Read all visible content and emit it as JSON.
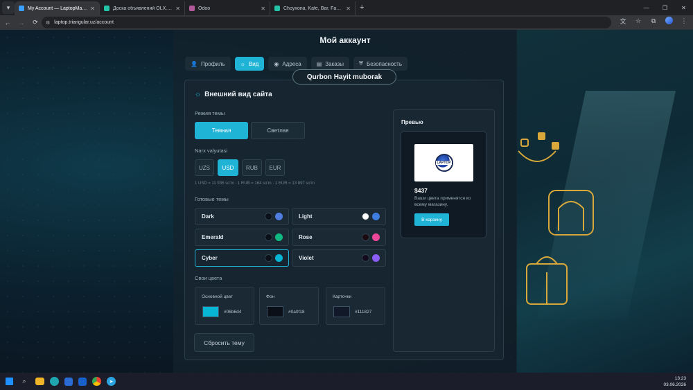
{
  "browser": {
    "tabs": [
      {
        "title": "My Account — LaptopMarket |",
        "active": true,
        "favicon_color": "#3aa0ff"
      },
      {
        "title": "Доска объявлений OLX.uz, ра",
        "active": false,
        "favicon_color": "#23c4a8"
      },
      {
        "title": "Odoo",
        "active": false,
        "favicon_color": "#b05a9b"
      },
      {
        "title": "Choyxona, Kafe, Bar, FastFood",
        "active": false,
        "favicon_color": "#23c4a8"
      }
    ],
    "new_tab": "+",
    "url": "laptop.triangular.uz/account",
    "window_controls": {
      "minimize": "—",
      "restore": "❐",
      "close": "✕"
    }
  },
  "page": {
    "title": "Мой аккаунт",
    "nav_tabs": [
      {
        "label": "Профиль",
        "icon": "👤",
        "active": false
      },
      {
        "label": "Вид",
        "icon": "☼",
        "active": true
      },
      {
        "label": "Адреса",
        "icon": "◉",
        "active": false
      },
      {
        "label": "Заказы",
        "icon": "▤",
        "active": false
      },
      {
        "label": "Безопасность",
        "icon": "⛨",
        "active": false
      }
    ],
    "banner": "Qurbon Hayit muborak",
    "appearance": {
      "title": "Внешний вид сайта",
      "theme_mode_label": "Режим темы",
      "dark_label": "Темная",
      "light_label": "Светлая",
      "currency_label": "Narx valyutasi",
      "currencies": [
        "UZS",
        "USD",
        "RUB",
        "EUR"
      ],
      "active_currency": "USD",
      "rates": "1 USD = 11 935 so'm · 1 RUB = 164 so'm · 1 EUR = 13 897 so'm",
      "themes_label": "Готовые темы",
      "themes": [
        {
          "name": "Dark",
          "c1": "#0a0f18",
          "c2": "#4f7de0"
        },
        {
          "name": "Light",
          "c1": "#ffffff",
          "c2": "#3f7de0"
        },
        {
          "name": "Emerald",
          "c1": "#0a0f18",
          "c2": "#10b981"
        },
        {
          "name": "Rose",
          "c1": "#1a0a10",
          "c2": "#ec4899"
        },
        {
          "name": "Cyber",
          "c1": "#0a0f18",
          "c2": "#06b6d4"
        },
        {
          "name": "Violet",
          "c1": "#140a1e",
          "c2": "#8b5cf6"
        }
      ],
      "selected_theme": "Cyber",
      "custom_colors_label": "Свои цвета",
      "custom_colors": [
        {
          "label": "Основной цвет",
          "value": "#06b6d4"
        },
        {
          "label": "Фон",
          "value": "#0a0f18"
        },
        {
          "label": "Карточки",
          "value": "#111827"
        }
      ],
      "reset_label": "Сбросить тему"
    },
    "preview": {
      "label": "Превью",
      "logo_text": "LAPTOP",
      "price": "$437",
      "description": "Ваши цвета применятся ко всему магазину.",
      "cart_label": "В корзину"
    }
  },
  "taskbar": {
    "time": "13:23",
    "date": "03.06.2026"
  },
  "colors": {
    "accent": "#1fb3d6"
  }
}
